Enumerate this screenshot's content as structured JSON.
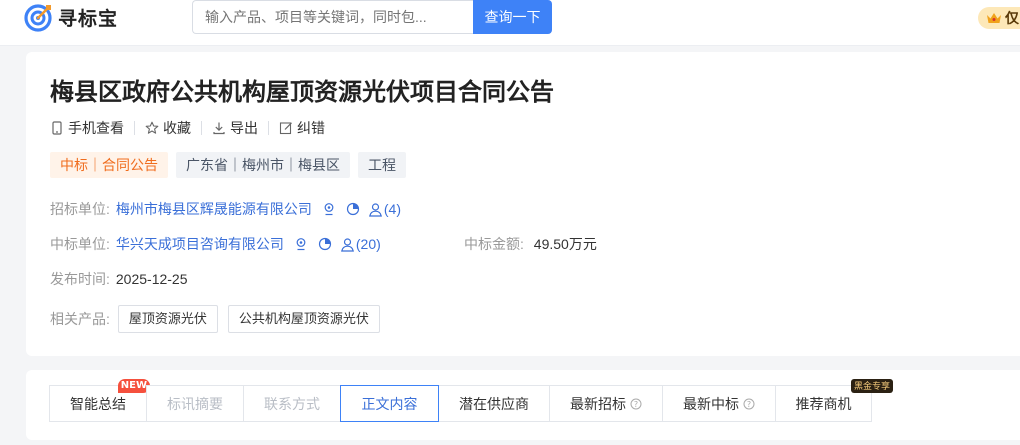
{
  "header": {
    "logo_text": "寻标宝",
    "search_placeholder": "输入产品、项目等关键词，同时包...",
    "search_button": "查询一下",
    "vip_text": "仅"
  },
  "notice": {
    "title": "梅县区政府公共机构屋顶资源光伏项目合同公告",
    "actions": [
      {
        "label": "手机查看",
        "icon": "phone-icon"
      },
      {
        "label": "收藏",
        "icon": "star-icon"
      },
      {
        "label": "导出",
        "icon": "download-icon"
      },
      {
        "label": "纠错",
        "icon": "edit-icon"
      }
    ],
    "tags": {
      "type": "中标｜合同公告",
      "region": "广东省｜梅州市｜梅县区",
      "category": "工程"
    },
    "tenderer": {
      "label": "招标单位:",
      "name": "梅州市梅县区辉晟能源有限公司",
      "contacts": "(4)"
    },
    "winner": {
      "label": "中标单位:",
      "name": "华兴天成项目咨询有限公司",
      "contacts": "(20)"
    },
    "amount": {
      "label": "中标金额:",
      "value": "49.50万元"
    },
    "publish": {
      "label": "发布时间:",
      "value": "2025-12-25"
    },
    "products": {
      "label": "相关产品:",
      "items": [
        "屋顶资源光伏",
        "公共机构屋顶资源光伏"
      ]
    }
  },
  "tabs": [
    {
      "label": "智能总结",
      "badge": "NEW"
    },
    {
      "label": "标讯摘要"
    },
    {
      "label": "联系方式"
    },
    {
      "label": "正文内容"
    },
    {
      "label": "潜在供应商"
    },
    {
      "label": "最新招标"
    },
    {
      "label": "最新中标"
    },
    {
      "label": "推荐商机",
      "badge": "黑金专享"
    }
  ],
  "colors": {
    "primary": "#3e82f7",
    "link": "#3a6fd8",
    "orange": "#f06d1e",
    "new_badge": "#f5503d"
  }
}
